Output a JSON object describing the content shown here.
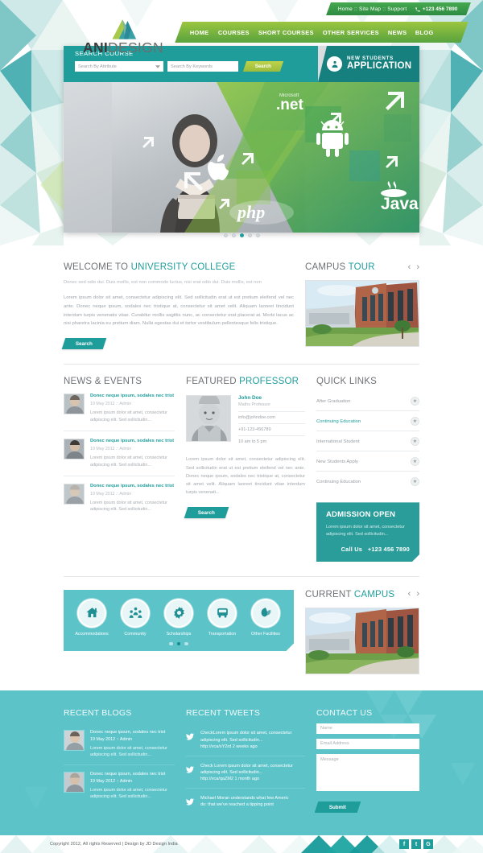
{
  "topbar": {
    "links": "Home :: Site Map :: Support",
    "phone": "+123 456 7890",
    "phone_icon": "phone-icon"
  },
  "logo": {
    "part1": "ANI",
    "part2": "DESIGN"
  },
  "nav": {
    "items": [
      {
        "label": "HOME"
      },
      {
        "label": "COURSES"
      },
      {
        "label": "SHORT COURSES"
      },
      {
        "label": "OTHER SERVICES"
      },
      {
        "label": "NEWS"
      },
      {
        "label": "BLOG"
      }
    ]
  },
  "hero": {
    "search_title": "SEARCH COURSE",
    "attribute_placeholder": "Search By Attribute",
    "keywords_placeholder": "Search By Keywords",
    "search_button": "Search",
    "new_students_line1": "NEW STUDENTS",
    "new_students_line2": "APPLICATION",
    "new_students_icon": "user-group-icon",
    "tech_logos": [
      "Microsoft .net",
      "Android",
      "Apple",
      "Java",
      "php"
    ],
    "slides_total": 5,
    "active_slide": 3
  },
  "welcome": {
    "title_plain": "WELCOME TO ",
    "title_accent": "UNIVERSITY COLLEGE",
    "subtitle": "Donec sed odio dui. Duis mollis, est non commodo luctus, nisi erat odio dui. Duis mollis, est non",
    "body": "Lorem ipsum dolor sit amet, consectetur adipiscing elit. Sed sollicitudin erat ut est pretium eleifend vel nec ante. Donec neque ipsum, sodales nec tristique at, consectetur sit amet velit. Aliquam laoreet tincidunt interdum turpis venenatis vitae. Curabitur mollis sagittis nunc, ac consectetur erat placerat at. Morbi lacus ac nisi pharetra lacinia eu pretium diam. Nulla egestas dui et tortor vestibulum pellentesque felis tristique.",
    "button": "Search"
  },
  "campus_tour": {
    "title_plain": "CAMPUS ",
    "title_accent": "TOUR",
    "prev_icon": "chevron-left-icon",
    "next_icon": "chevron-right-icon"
  },
  "news": {
    "title": "NEWS & EVENTS",
    "items": [
      {
        "title": "Donec neque ipsum, sodales nec trist",
        "meta": "19 May 2012 :: Admin",
        "text": "Lorem ipsum dolor sit amet, consectetur adipiscing elit. Sed sollicitudin..."
      },
      {
        "title": "Donec neque ipsum, sodales nec trist",
        "meta": "19 May 2012 :: Admin",
        "text": "Lorem ipsum dolor sit amet, consectetur adipiscing elit. Sed sollicitudin..."
      },
      {
        "title": "Donec neque ipsum, sodales nec trist",
        "meta": "19 May 2012 :: Admin",
        "text": "Lorem ipsum dolor sit amet, consectetur adipiscing elit. Sed sollicitudin..."
      }
    ]
  },
  "professor": {
    "title_plain": "FEATURED ",
    "title_accent": "PROFESSOR",
    "name": "John Doe",
    "role": "Maths Professor",
    "email": "info@johndoe.com",
    "phone": "+91-123-456789",
    "hours": "10 am to 5 pm",
    "body": "Lorem ipsum dolor sit amet, consectetur adipiscing elit. Sed sollicitudin erat ut est pretium eleifend vel nec ante. Donec neque ipsum, sodales nec tristique at, consectetur sit amet velit. Aliquam laoreet tincidunt vitae interdum turpis venenati...",
    "button": "Search"
  },
  "quick_links": {
    "title": "QUICK LINKS",
    "items": [
      {
        "label": "After Graduation",
        "highlight": false
      },
      {
        "label": "Continuing Education",
        "highlight": true
      },
      {
        "label": "International Student",
        "highlight": false
      },
      {
        "label": "New Students Apply",
        "highlight": false
      },
      {
        "label": "Continuing Education",
        "highlight": false
      }
    ],
    "star_icon": "star-icon"
  },
  "admission": {
    "title": "ADMISSION OPEN",
    "text": "Lorem ipsum dolor sit amet, consectetur adipiscing elit. Sed sollicitudin...",
    "call_label": "Call Us",
    "call_number": "+123 456 7890"
  },
  "facilities": {
    "items": [
      {
        "label": "Accommodations",
        "icon": "home-icon"
      },
      {
        "label": "Community",
        "icon": "people-icon"
      },
      {
        "label": "Scholarships",
        "icon": "gear-icon"
      },
      {
        "label": "Transportation",
        "icon": "bus-icon"
      },
      {
        "label": "Other Facilities",
        "icon": "leaf-icon"
      }
    ],
    "dots_total": 3,
    "active_dot": 2
  },
  "current_campus": {
    "title_plain": "CURRENT ",
    "title_accent": "CAMPUS",
    "prev_icon": "chevron-left-icon",
    "next_icon": "chevron-right-icon"
  },
  "recent_blogs": {
    "title": "RECENT BLOGS",
    "items": [
      {
        "title": "Donec neque ipsum, sodales nec trist",
        "meta": "19 May 2012 :: Admin",
        "text": "Lorem ipsum dolor sit amet, consectetur adipiscing elit. Sed sollicitudin..."
      },
      {
        "title": "Donec neque ipsum, sodales nec trist",
        "meta": "19 May 2012 :: Admin",
        "text": "Lorem ipsum dolor sit amet, consectetur adipiscing elit. Sed sollicitudin..."
      }
    ]
  },
  "recent_tweets": {
    "title": "RECENT TWEETS",
    "icon": "twitter-bird-icon",
    "items": [
      {
        "text": "CheckLorem ipsum dolor sit amet, consectetur adipiscing elit. Sed sollicitudin...",
        "link": "http://vca/sY2rd 2 weeks ago"
      },
      {
        "text": "Check Lorem ipsum dolor sit amet, consectetur adipiscing elit. Sed sollicitudin...",
        "link": "http://vca/qaZM2 1 month ago"
      },
      {
        "text": "Michael Moran understands what few Americ",
        "link": "do: that we've reached a tipping point"
      }
    ]
  },
  "contact": {
    "title": "CONTACT US",
    "name_placeholder": "Name",
    "email_placeholder": "Email Address",
    "message_placeholder": "Message",
    "submit": "Submit"
  },
  "copyright": {
    "text": "Copyright 2012, All rights Reserved   |   Design by JD Design India",
    "social": [
      {
        "name": "facebook-icon",
        "glyph": "f"
      },
      {
        "name": "twitter-icon",
        "glyph": "t"
      },
      {
        "name": "google-plus-icon",
        "glyph": "G"
      }
    ]
  },
  "colors": {
    "teal": "#1f9d9b",
    "light_teal": "#5cc3c9",
    "green": "#76b23f",
    "lime": "#9cc63f"
  }
}
